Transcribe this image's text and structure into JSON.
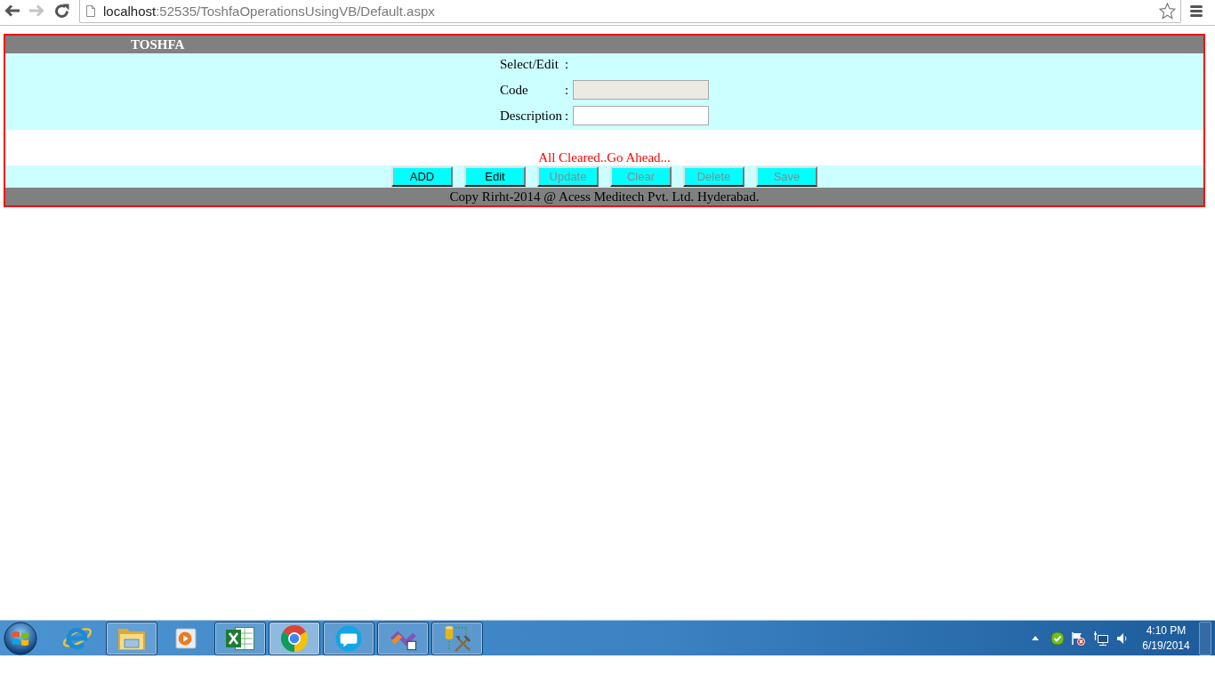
{
  "browser": {
    "nav": [
      {
        "kind": "back",
        "disabled": false
      },
      {
        "kind": "forward",
        "disabled": true
      },
      {
        "kind": "reload",
        "disabled": false
      }
    ],
    "address": {
      "host": "localhost",
      "path": ":52535/ToshfaOperationsUsingVB/Default.aspx"
    },
    "bookmarked": false
  },
  "page": {
    "title": "TOSHFA",
    "fields": [
      {
        "label": "Select/Edit",
        "separator": ":",
        "kind": "empty"
      },
      {
        "label": "Code",
        "separator": ":",
        "kind": "input",
        "disabled": true
      },
      {
        "label": "Description",
        "separator": ":",
        "kind": "input",
        "disabled": false
      }
    ],
    "message": "All Cleared..Go Ahead...",
    "buttons": [
      {
        "label": "ADD",
        "disabled": false
      },
      {
        "label": "Edit",
        "disabled": false
      },
      {
        "label": "Update",
        "disabled": true
      },
      {
        "label": "Clear",
        "disabled": true
      },
      {
        "label": "Delete",
        "disabled": true
      },
      {
        "label": "Save",
        "disabled": true
      }
    ],
    "footer": "Copy Rirht-2014 @ Acess Meditech Pvt. Ltd. Hyderabad."
  },
  "taskbar": {
    "apps": [
      {
        "kind": "globe",
        "running": false,
        "selected": false
      },
      {
        "kind": "folder",
        "running": true,
        "selected": false
      },
      {
        "kind": "player",
        "running": false,
        "selected": false
      },
      {
        "kind": "spreadsheet",
        "running": true,
        "selected": false
      },
      {
        "kind": "browser",
        "running": true,
        "selected": true
      },
      {
        "kind": "chat",
        "running": true,
        "selected": false
      },
      {
        "kind": "studio",
        "running": true,
        "selected": false
      },
      {
        "kind": "database",
        "running": true,
        "selected": false
      }
    ],
    "clock": {
      "time": "4:10 PM",
      "date": "6/19/2014"
    }
  }
}
